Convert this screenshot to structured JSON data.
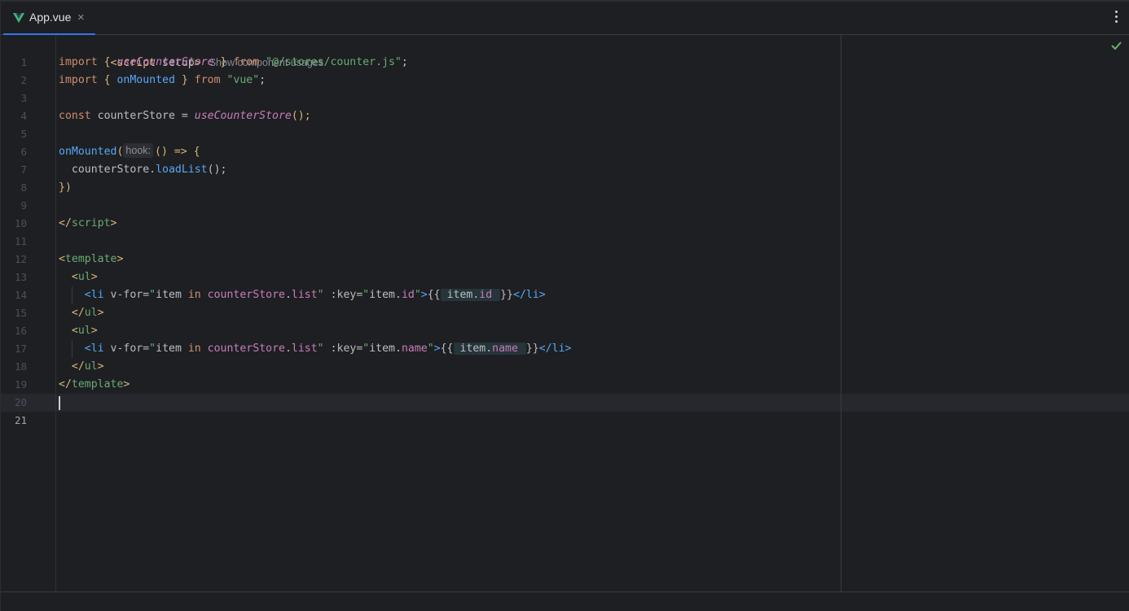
{
  "tab": {
    "title": "App.vue",
    "close_glyph": "×",
    "icon": "vue-logo-icon"
  },
  "editor": {
    "usages_hint": "Show component usages",
    "param_hint": "hook:",
    "current_line": 21,
    "status_icon": "check-icon",
    "colors": {
      "accent": "#3574f0",
      "background": "#1e1f22",
      "check": "#5fb865"
    },
    "lines": [
      "1",
      "2",
      "3",
      "4",
      "5",
      "6",
      "7",
      "8",
      "9",
      "10",
      "11",
      "12",
      "13",
      "14",
      "15",
      "16",
      "17",
      "18",
      "19",
      "20",
      "21"
    ],
    "code": {
      "l1_a": "<script",
      "l1_b": " setup",
      "l1_c": ">",
      "l2_kw": "import",
      "l2_b1": " { ",
      "l2_fn": "useCounterStore",
      "l2_b2": " } ",
      "l2_from": "from",
      "l2_str": " \"@/stores/counter.js\"",
      "l2_semi": ";",
      "l3_kw": "import",
      "l3_b1": " { ",
      "l3_fn": "onMounted",
      "l3_b2": " } ",
      "l3_from": "from",
      "l3_str": " \"vue\"",
      "l3_semi": ";",
      "l5_kw": "const",
      "l5_var": " counterStore = ",
      "l5_fn": "useCounterStore",
      "l5_end": "();",
      "l7_fn": "onMounted",
      "l7_p": "(",
      "l7_rest": "() => {",
      "l8_indent": "  ",
      "l8_obj": "counterStore.",
      "l8_fn": "loadList",
      "l8_end": "();",
      "l9": "})",
      "l11_open": "</",
      "l11_name": "script",
      "l11_close": ">",
      "l13_open": "<",
      "l13_name": "template",
      "l13_close": ">",
      "l14_open": "  <",
      "l14_name": "ul",
      "l14_close": ">",
      "l15_open": "    <",
      "l15_name": "li",
      "l15_attr1": " v-for=",
      "l15_q1": "\"",
      "l15_item1": "item ",
      "l15_in": "in",
      "l15_sp": " ",
      "l15_store": "counterStore",
      "l15_dot1": ".",
      "l15_list": "list",
      "l15_q2": "\"",
      "l15_attr2": " :key=",
      "l15_q3": "\"",
      "l15_item2": "item",
      "l15_dot2": ".",
      "l15_id": "id",
      "l15_q4": "\"",
      "l15_gt": ">",
      "l15_ob": "{{",
      "l15_ex1": " item",
      "l15_exdot": ".",
      "l15_ex2": "id ",
      "l15_cb": "}}",
      "l15_lt": "</",
      "l15_ename": "li",
      "l15_egt": ">",
      "l16_open": "  </",
      "l16_name": "ul",
      "l16_close": ">",
      "l17_open": "  <",
      "l17_name": "ul",
      "l17_close": ">",
      "l18_open": "    <",
      "l18_name": "li",
      "l18_attr1": " v-for=",
      "l18_q1": "\"",
      "l18_item1": "item ",
      "l18_in": "in",
      "l18_sp": " ",
      "l18_store": "counterStore",
      "l18_dot1": ".",
      "l18_list": "list",
      "l18_q2": "\"",
      "l18_attr2": " :key=",
      "l18_q3": "\"",
      "l18_item2": "item",
      "l18_dot2": ".",
      "l18_name2": "name",
      "l18_q4": "\"",
      "l18_gt": ">",
      "l18_ob": "{{",
      "l18_ex1": " item",
      "l18_exdot": ".",
      "l18_ex2": "name ",
      "l18_cb": "}}",
      "l18_lt": "</",
      "l18_ename": "li",
      "l18_egt": ">",
      "l19_open": "  </",
      "l19_name": "ul",
      "l19_close": ">",
      "l20_open": "</",
      "l20_name": "template",
      "l20_close": ">"
    }
  }
}
